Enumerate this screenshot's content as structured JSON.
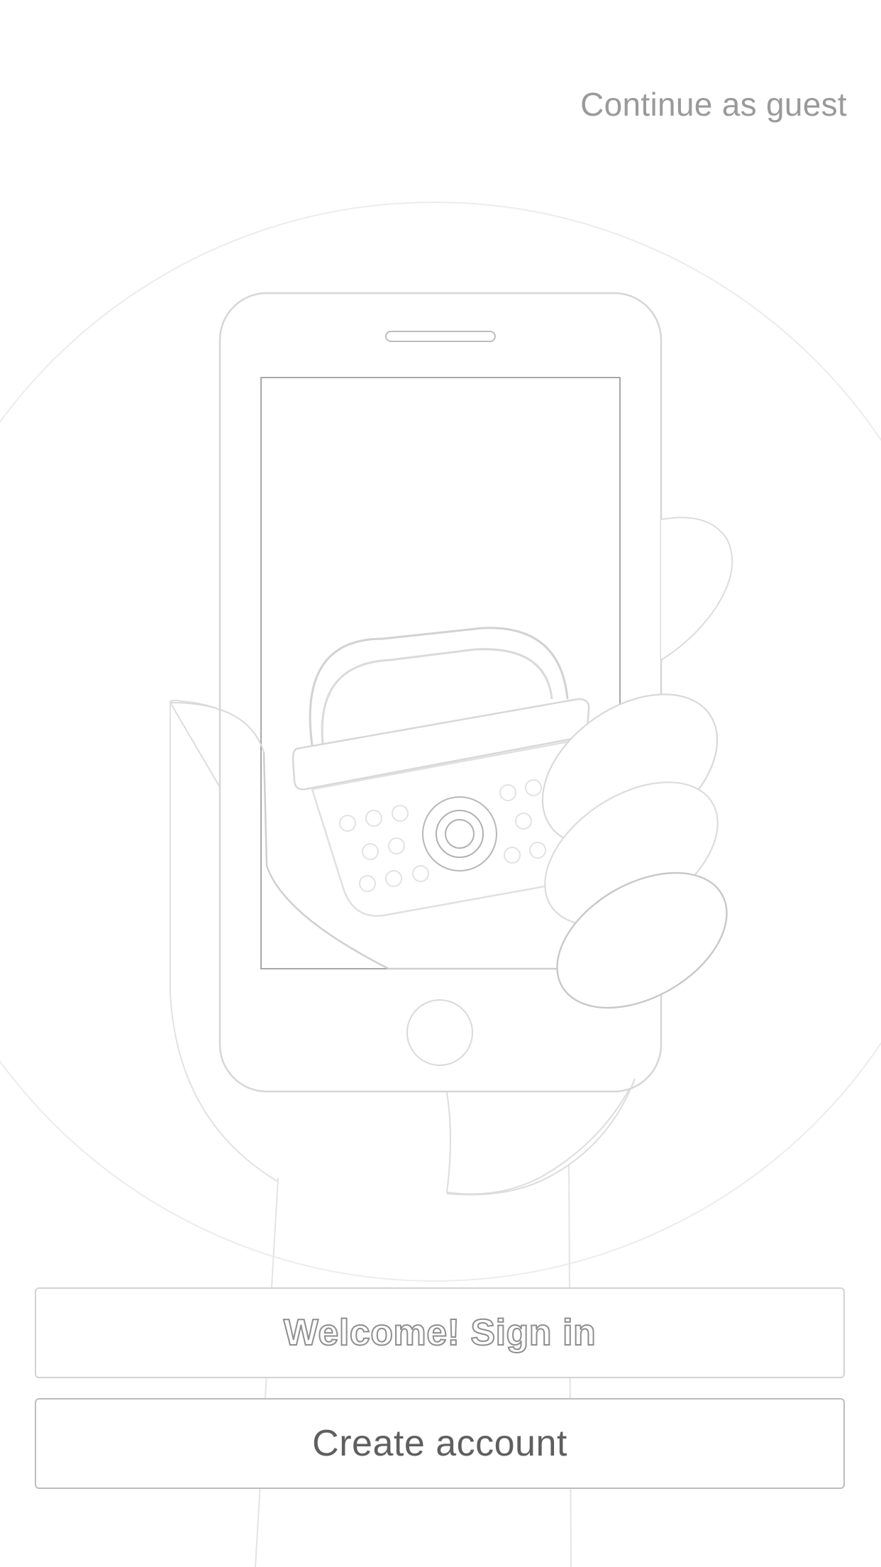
{
  "header": {
    "guest_link_label": "Continue as guest"
  },
  "actions": {
    "sign_in_label": "Welcome! Sign in",
    "create_account_label": "Create account"
  },
  "illustration": {
    "subject": "hand-holding-phone-with-shopping-basket-icon"
  },
  "colors": {
    "background": "#ffffff",
    "line": "#cfcfcf",
    "text_muted": "#9a9a9a",
    "text_button": "#5f5f5f",
    "button_border": "#c8c8c8"
  }
}
